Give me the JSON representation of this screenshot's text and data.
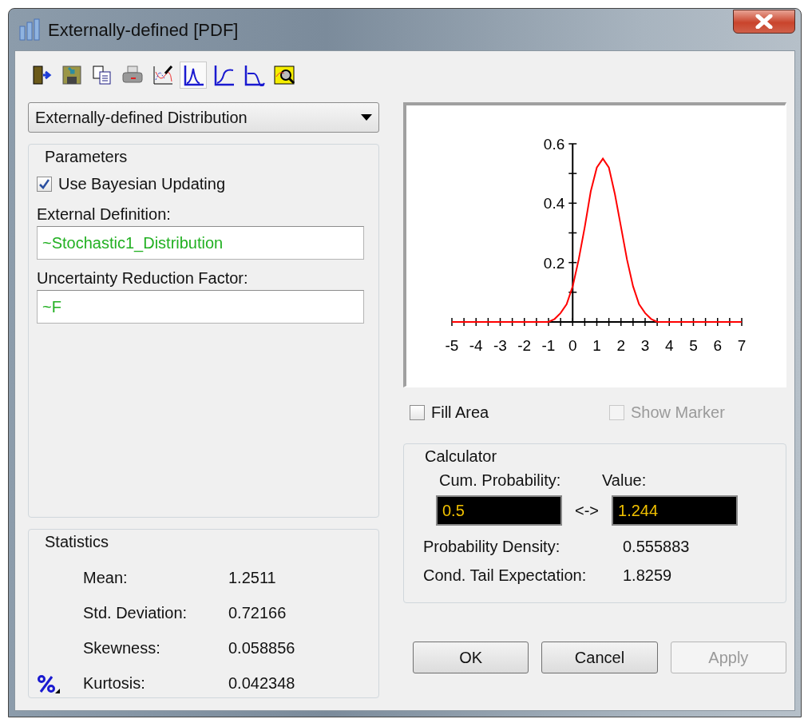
{
  "window": {
    "title": "Externally-defined [PDF]"
  },
  "toolbar": [
    {
      "kind": "exit",
      "selected": false
    },
    {
      "kind": "save",
      "selected": false
    },
    {
      "kind": "copy",
      "selected": false
    },
    {
      "kind": "print",
      "selected": false
    },
    {
      "kind": "format",
      "selected": false
    },
    {
      "kind": "pdf",
      "selected": true
    },
    {
      "kind": "cdf",
      "selected": false
    },
    {
      "kind": "ccdf",
      "selected": false
    },
    {
      "kind": "zoom",
      "selected": false
    }
  ],
  "distribution": {
    "value": "Externally-defined Distribution"
  },
  "parameters": {
    "title": "Parameters",
    "checkbox": {
      "label": "Use Bayesian Updating",
      "checked": true
    },
    "fields": [
      {
        "label": "External Definition:",
        "value": "~Stochastic1_Distribution"
      },
      {
        "label": "Uncertainty Reduction Factor:",
        "value": "~F"
      }
    ]
  },
  "statistics": {
    "title": "Statistics",
    "rows": [
      {
        "label": "Mean:",
        "value": "1.2511"
      },
      {
        "label": "Std. Deviation:",
        "value": "0.72166"
      },
      {
        "label": "Skewness:",
        "value": "0.058856"
      },
      {
        "label": "Kurtosis:",
        "value": "0.042348"
      }
    ]
  },
  "chart_data": {
    "type": "line",
    "x": [
      -5,
      -1,
      -0.75,
      -0.5,
      -0.25,
      0,
      0.25,
      0.5,
      0.75,
      1,
      1.25,
      1.5,
      1.75,
      2,
      2.25,
      2.5,
      2.75,
      3,
      3.25,
      3.5,
      3.75,
      7
    ],
    "series": [
      {
        "color": "#ff0000",
        "values": [
          0,
          0,
          0.01,
          0.03,
          0.06,
          0.12,
          0.21,
          0.32,
          0.44,
          0.52,
          0.55,
          0.52,
          0.43,
          0.32,
          0.21,
          0.12,
          0.06,
          0.03,
          0.01,
          0,
          0,
          0
        ]
      }
    ],
    "xlim": [
      -5,
      7
    ],
    "ylim": [
      0,
      0.6
    ],
    "xticks": [
      -5,
      -4,
      -3,
      -2,
      -1,
      0,
      1,
      2,
      3,
      4,
      5,
      6,
      7
    ],
    "yticks": [
      0.2,
      0.4,
      0.6
    ]
  },
  "options": [
    {
      "label": "Fill Area",
      "checked": false,
      "disabled": false
    },
    {
      "label": "Show Marker",
      "checked": false,
      "disabled": true
    }
  ],
  "calculator": {
    "title": "Calculator",
    "cum_label": "Cum. Probability:",
    "value_label": "Value:",
    "cum_value": "0.5",
    "arrow": "<->",
    "value_value": "1.244",
    "rows": [
      {
        "label": "Probability Density:",
        "value": "0.555883"
      },
      {
        "label": "Cond. Tail Expectation:",
        "value": "1.8259"
      }
    ]
  },
  "buttons": [
    {
      "label": "OK",
      "disabled": false
    },
    {
      "label": "Cancel",
      "disabled": false
    },
    {
      "label": "Apply",
      "disabled": true
    }
  ]
}
